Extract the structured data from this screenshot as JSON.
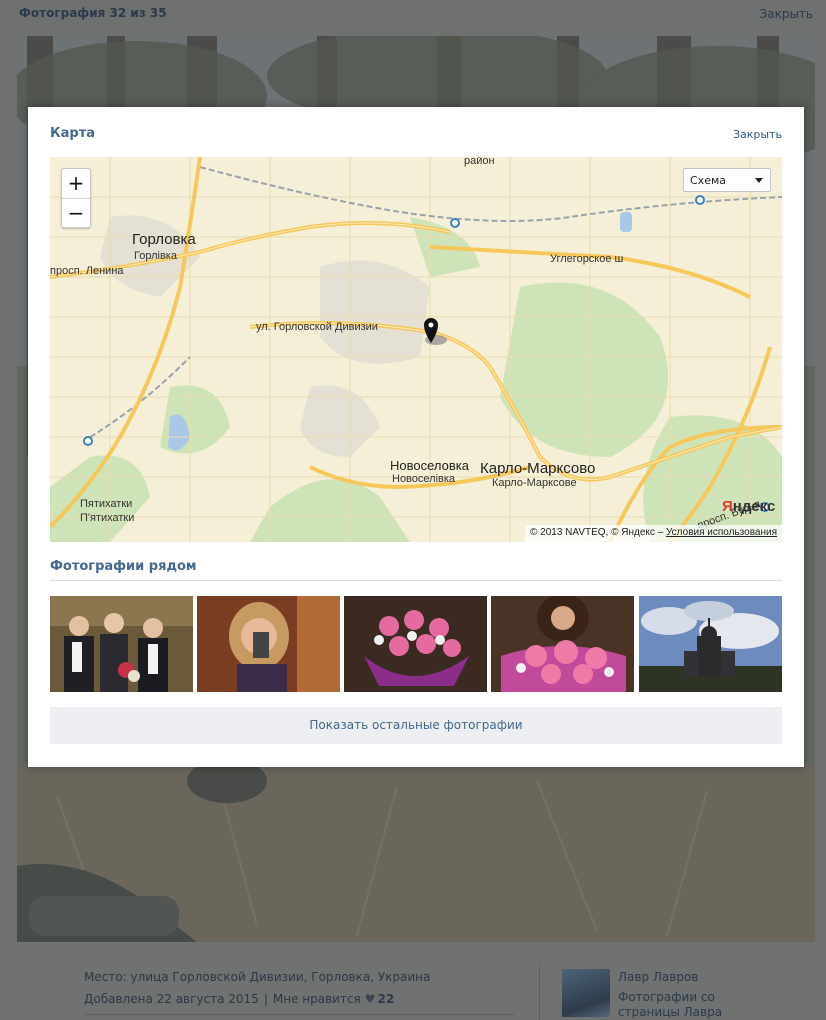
{
  "viewer": {
    "title": "Фотография 32 из 35",
    "close_label": "Закрыть"
  },
  "modal": {
    "title": "Карта",
    "close_label": "Закрыть"
  },
  "map": {
    "zoom_in": "+",
    "zoom_out": "−",
    "map_type": "Схема",
    "labels": {
      "gorlovka": "Горловка",
      "gorlivka": "Горлівка",
      "prosp_lenina": "просп. Ленина",
      "gorlovskoy_divizii": "ул. Горловской Дивизии",
      "uglegorskoe": "Углегорское ш",
      "novoselovka": "Новоселовка",
      "novoselivka": "Новоселівка",
      "karlo_marksovo": "Карло-Марксово",
      "karlo_marksove": "Карло-Марксове",
      "pyatikhatki": "Пятихатки",
      "piatikhatki_ua": "П'ятихатки",
      "rayon": "район",
      "prosp_bottom": "просп. Бурья"
    },
    "logo_first": "Я",
    "logo_rest": "ндекс",
    "copyright": "© 2013 NAVTEQ, © Яндекс –",
    "terms": "Условия использования"
  },
  "nearby": {
    "title": "Фотографии рядом",
    "thumbs": [
      {
        "name": "thumb-children-school"
      },
      {
        "name": "thumb-girl-selfie"
      },
      {
        "name": "thumb-rose-bouquet"
      },
      {
        "name": "thumb-girl-roses"
      },
      {
        "name": "thumb-church"
      }
    ],
    "show_more": "Показать остальные фотографии"
  },
  "info": {
    "place": "Место: улица Горловской Дивизии, Горловка, Украина",
    "added": "Добавлена 22 августа 2015",
    "separator": "|",
    "like_label": "Мне нравится",
    "likes": "22",
    "owner_name": "Лавр Лавров",
    "album": "Фотографии со страницы Лавра"
  },
  "colors": {
    "link": "#45688e",
    "map_road": "#f6c85b",
    "map_bg": "#f4efd6"
  }
}
